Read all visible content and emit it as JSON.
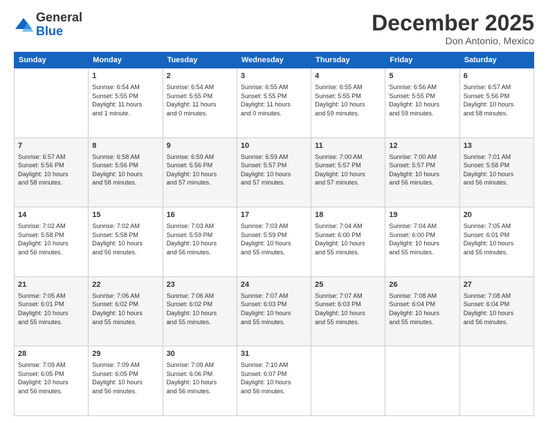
{
  "logo": {
    "general": "General",
    "blue": "Blue"
  },
  "title": "December 2025",
  "location": "Don Antonio, Mexico",
  "days_of_week": [
    "Sunday",
    "Monday",
    "Tuesday",
    "Wednesday",
    "Thursday",
    "Friday",
    "Saturday"
  ],
  "weeks": [
    [
      {
        "day": "",
        "info": ""
      },
      {
        "day": "1",
        "info": "Sunrise: 6:54 AM\nSunset: 5:55 PM\nDaylight: 11 hours\nand 1 minute."
      },
      {
        "day": "2",
        "info": "Sunrise: 6:54 AM\nSunset: 5:55 PM\nDaylight: 11 hours\nand 0 minutes."
      },
      {
        "day": "3",
        "info": "Sunrise: 6:55 AM\nSunset: 5:55 PM\nDaylight: 11 hours\nand 0 minutes."
      },
      {
        "day": "4",
        "info": "Sunrise: 6:55 AM\nSunset: 5:55 PM\nDaylight: 10 hours\nand 59 minutes."
      },
      {
        "day": "5",
        "info": "Sunrise: 6:56 AM\nSunset: 5:55 PM\nDaylight: 10 hours\nand 59 minutes."
      },
      {
        "day": "6",
        "info": "Sunrise: 6:57 AM\nSunset: 5:56 PM\nDaylight: 10 hours\nand 58 minutes."
      }
    ],
    [
      {
        "day": "7",
        "info": "Sunrise: 6:57 AM\nSunset: 5:56 PM\nDaylight: 10 hours\nand 58 minutes."
      },
      {
        "day": "8",
        "info": "Sunrise: 6:58 AM\nSunset: 5:56 PM\nDaylight: 10 hours\nand 58 minutes."
      },
      {
        "day": "9",
        "info": "Sunrise: 6:59 AM\nSunset: 5:56 PM\nDaylight: 10 hours\nand 57 minutes."
      },
      {
        "day": "10",
        "info": "Sunrise: 6:59 AM\nSunset: 5:57 PM\nDaylight: 10 hours\nand 57 minutes."
      },
      {
        "day": "11",
        "info": "Sunrise: 7:00 AM\nSunset: 5:57 PM\nDaylight: 10 hours\nand 57 minutes."
      },
      {
        "day": "12",
        "info": "Sunrise: 7:00 AM\nSunset: 5:57 PM\nDaylight: 10 hours\nand 56 minutes."
      },
      {
        "day": "13",
        "info": "Sunrise: 7:01 AM\nSunset: 5:58 PM\nDaylight: 10 hours\nand 56 minutes."
      }
    ],
    [
      {
        "day": "14",
        "info": "Sunrise: 7:02 AM\nSunset: 5:58 PM\nDaylight: 10 hours\nand 56 minutes."
      },
      {
        "day": "15",
        "info": "Sunrise: 7:02 AM\nSunset: 5:58 PM\nDaylight: 10 hours\nand 56 minutes."
      },
      {
        "day": "16",
        "info": "Sunrise: 7:03 AM\nSunset: 5:59 PM\nDaylight: 10 hours\nand 56 minutes."
      },
      {
        "day": "17",
        "info": "Sunrise: 7:03 AM\nSunset: 5:59 PM\nDaylight: 10 hours\nand 55 minutes."
      },
      {
        "day": "18",
        "info": "Sunrise: 7:04 AM\nSunset: 6:00 PM\nDaylight: 10 hours\nand 55 minutes."
      },
      {
        "day": "19",
        "info": "Sunrise: 7:04 AM\nSunset: 6:00 PM\nDaylight: 10 hours\nand 55 minutes."
      },
      {
        "day": "20",
        "info": "Sunrise: 7:05 AM\nSunset: 6:01 PM\nDaylight: 10 hours\nand 55 minutes."
      }
    ],
    [
      {
        "day": "21",
        "info": "Sunrise: 7:05 AM\nSunset: 6:01 PM\nDaylight: 10 hours\nand 55 minutes."
      },
      {
        "day": "22",
        "info": "Sunrise: 7:06 AM\nSunset: 6:02 PM\nDaylight: 10 hours\nand 55 minutes."
      },
      {
        "day": "23",
        "info": "Sunrise: 7:06 AM\nSunset: 6:02 PM\nDaylight: 10 hours\nand 55 minutes."
      },
      {
        "day": "24",
        "info": "Sunrise: 7:07 AM\nSunset: 6:03 PM\nDaylight: 10 hours\nand 55 minutes."
      },
      {
        "day": "25",
        "info": "Sunrise: 7:07 AM\nSunset: 6:03 PM\nDaylight: 10 hours\nand 55 minutes."
      },
      {
        "day": "26",
        "info": "Sunrise: 7:08 AM\nSunset: 6:04 PM\nDaylight: 10 hours\nand 55 minutes."
      },
      {
        "day": "27",
        "info": "Sunrise: 7:08 AM\nSunset: 6:04 PM\nDaylight: 10 hours\nand 56 minutes."
      }
    ],
    [
      {
        "day": "28",
        "info": "Sunrise: 7:09 AM\nSunset: 6:05 PM\nDaylight: 10 hours\nand 56 minutes."
      },
      {
        "day": "29",
        "info": "Sunrise: 7:09 AM\nSunset: 6:05 PM\nDaylight: 10 hours\nand 56 minutes."
      },
      {
        "day": "30",
        "info": "Sunrise: 7:09 AM\nSunset: 6:06 PM\nDaylight: 10 hours\nand 56 minutes."
      },
      {
        "day": "31",
        "info": "Sunrise: 7:10 AM\nSunset: 6:07 PM\nDaylight: 10 hours\nand 56 minutes."
      },
      {
        "day": "",
        "info": ""
      },
      {
        "day": "",
        "info": ""
      },
      {
        "day": "",
        "info": ""
      }
    ]
  ]
}
